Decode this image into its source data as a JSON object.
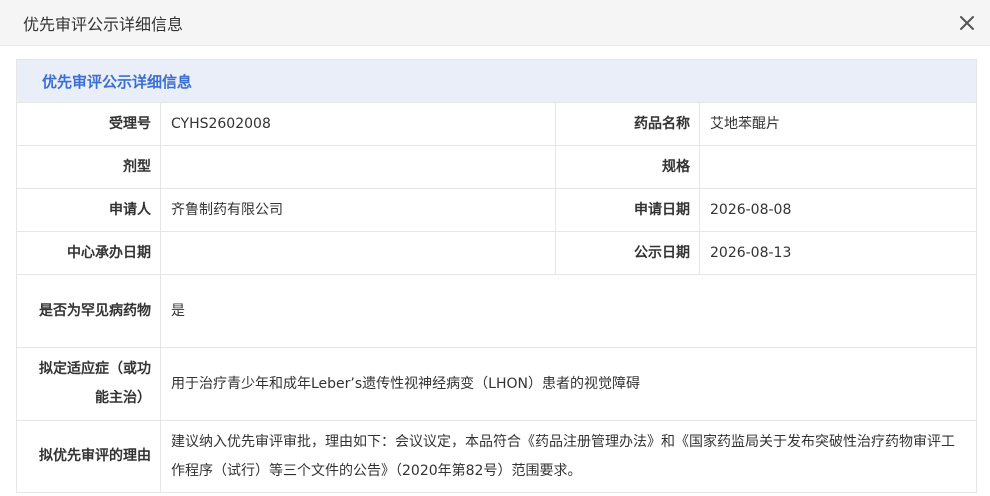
{
  "dialog": {
    "title": "优先审评公示详细信息"
  },
  "section": {
    "title": "优先审评公示详细信息"
  },
  "fields": {
    "accept_no": {
      "label": "受理号",
      "value": "CYHS2602008"
    },
    "drug_name": {
      "label": "药品名称",
      "value": "艾地苯醌片"
    },
    "dosage_form": {
      "label": "剂型",
      "value": ""
    },
    "spec": {
      "label": "规格",
      "value": ""
    },
    "applicant": {
      "label": "申请人",
      "value": "齐鲁制药有限公司"
    },
    "apply_date": {
      "label": "申请日期",
      "value": "2026-08-08"
    },
    "center_date": {
      "label": "中心承办日期",
      "value": ""
    },
    "publish_date": {
      "label": "公示日期",
      "value": "2026-08-13"
    },
    "rare_disease": {
      "label": "是否为罕见病药物",
      "value": "是"
    },
    "indication": {
      "label": "拟定适应症（或功能主治）",
      "value": "用于治疗青少年和成年Leber’s遗传性视神经病变（LHON）患者的视觉障碍"
    },
    "reason": {
      "label": "拟优先审评的理由",
      "value": "建议纳入优先审评审批，理由如下：会议议定，本品符合《药品注册管理办法》和《国家药监局关于发布突破性治疗药物审评工作程序（试行）等三个文件的公告》（2020年第82号）范围要求。"
    }
  }
}
